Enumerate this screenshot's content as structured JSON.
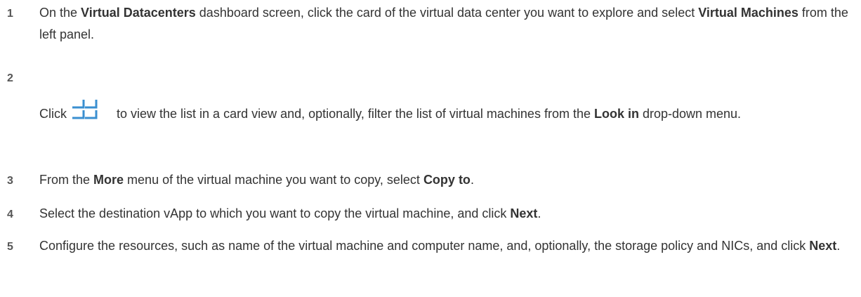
{
  "steps": [
    {
      "number": "1",
      "parts": [
        {
          "t": "On the ",
          "b": false
        },
        {
          "t": "Virtual Datacenters",
          "b": true
        },
        {
          "t": " dashboard screen, click the card of the virtual data center you want to explore and select ",
          "b": false
        },
        {
          "t": "Virtual Machines",
          "b": true
        },
        {
          "t": " from the left panel.",
          "b": false
        }
      ]
    },
    {
      "number": "2",
      "parts_before_icon": [
        {
          "t": "Click",
          "b": false
        }
      ],
      "icon": "card-view-icon",
      "parts_after_icon": [
        {
          "t": " to view the list in a card view and, optionally, filter the list of virtual machines from the ",
          "b": false
        },
        {
          "t": "Look in",
          "b": true
        },
        {
          "t": " drop-down menu.",
          "b": false
        }
      ]
    },
    {
      "number": "3",
      "parts": [
        {
          "t": "From the ",
          "b": false
        },
        {
          "t": "More",
          "b": true
        },
        {
          "t": " menu of the virtual machine you want to copy, select ",
          "b": false
        },
        {
          "t": "Copy to",
          "b": true
        },
        {
          "t": ".",
          "b": false
        }
      ]
    },
    {
      "number": "4",
      "parts": [
        {
          "t": "Select the destination vApp to which you want to copy the virtual machine, and click ",
          "b": false
        },
        {
          "t": "Next",
          "b": true
        },
        {
          "t": ".",
          "b": false
        }
      ]
    },
    {
      "number": "5",
      "parts": [
        {
          "t": "Configure the resources, such as name of the virtual machine and computer name, and, optionally, the storage policy and NICs, and click ",
          "b": false
        },
        {
          "t": "Next",
          "b": true
        },
        {
          "t": ".",
          "b": false
        }
      ]
    }
  ],
  "colors": {
    "text": "#333333",
    "number": "#565656",
    "icon": "#3a8fd0"
  }
}
